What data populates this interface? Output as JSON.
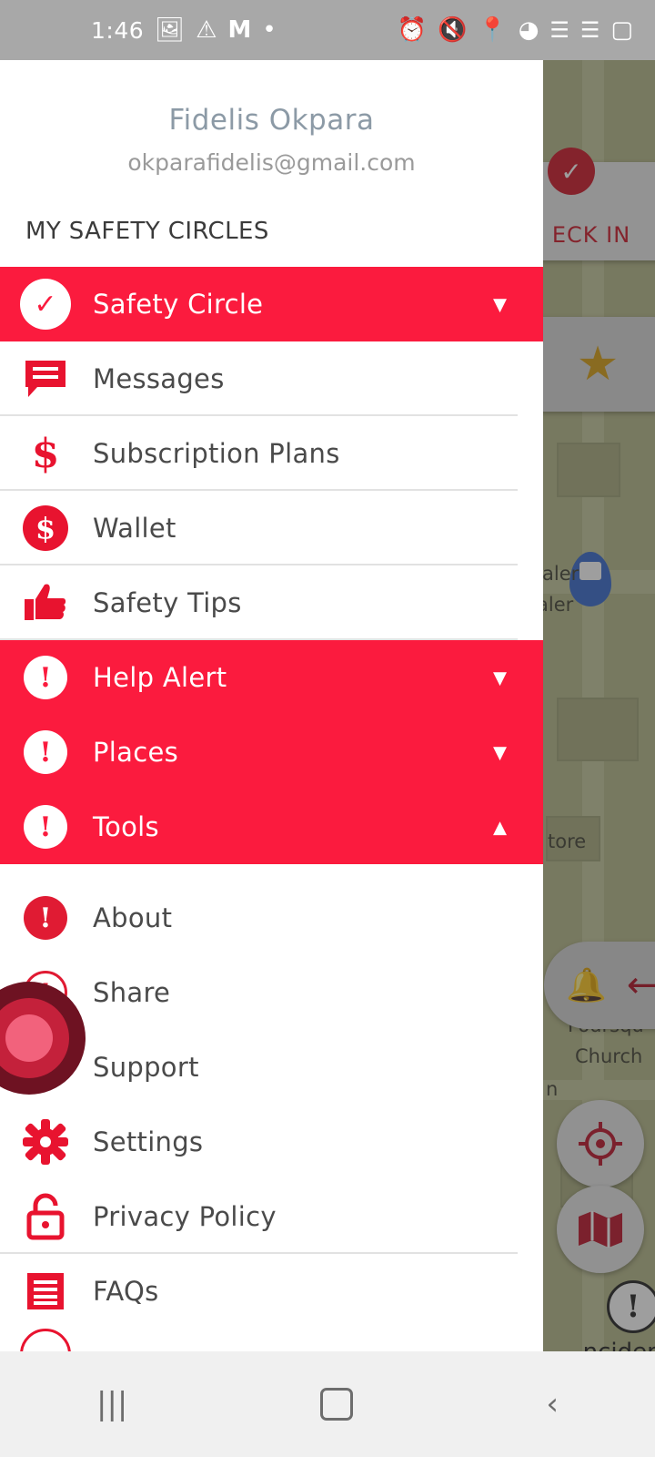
{
  "statusbar": {
    "clock": "1:46",
    "left_icons": [
      "image-icon",
      "warning-triangle-icon",
      "gmail-icon",
      "dot-icon"
    ],
    "right_icons": [
      "alarm-clock-icon",
      "mute-vibrate-icon",
      "location-pin-icon",
      "wifi-icon",
      "signal-bars-icon",
      "signal-bars-2-icon",
      "battery-icon"
    ]
  },
  "drawer": {
    "profile": {
      "name": "Fidelis Okpara",
      "email": "okparafidelis@gmail.com"
    },
    "section_title": "MY SAFETY CIRCLES",
    "accent_color": "#fb1b3e",
    "items": [
      {
        "label": "Safety Circle",
        "icon": "check-circle-icon",
        "highlighted": true,
        "chevron": "down"
      },
      {
        "label": "Messages",
        "icon": "chat-bubble-icon",
        "highlighted": false,
        "chevron": ""
      },
      {
        "label": "Subscription Plans",
        "icon": "dollar-sign-icon",
        "highlighted": false,
        "chevron": ""
      },
      {
        "label": "Wallet",
        "icon": "dollar-circle-icon",
        "highlighted": false,
        "chevron": ""
      },
      {
        "label": "Safety Tips",
        "icon": "thumbs-up-icon",
        "highlighted": false,
        "chevron": ""
      },
      {
        "label": "Help Alert",
        "icon": "exclamation-circle-icon",
        "highlighted": true,
        "chevron": "down"
      },
      {
        "label": "Places",
        "icon": "exclamation-circle-icon",
        "highlighted": true,
        "chevron": "down"
      },
      {
        "label": "Tools",
        "icon": "exclamation-circle-icon",
        "highlighted": true,
        "chevron": "up"
      },
      {
        "label": "About",
        "icon": "exclamation-circle-red-icon",
        "highlighted": false,
        "chevron": ""
      },
      {
        "label": "Share",
        "icon": "exclamation-circle-outline-icon",
        "highlighted": false,
        "chevron": ""
      },
      {
        "label": "Support",
        "icon": "headset-contact-icon",
        "highlighted": false,
        "chevron": ""
      },
      {
        "label": "Settings",
        "icon": "gear-icon",
        "highlighted": false,
        "chevron": ""
      },
      {
        "label": "Privacy Policy",
        "icon": "lock-icon",
        "highlighted": false,
        "chevron": ""
      },
      {
        "label": "FAQs",
        "icon": "list-document-icon",
        "highlighted": false,
        "chevron": ""
      }
    ]
  },
  "map": {
    "labels": [
      "aler",
      "aler",
      "tore",
      "n",
      "Foursqu",
      "Church"
    ],
    "checkin": {
      "label": "ECK IN",
      "badge_icon": "check-shield-icon"
    },
    "favorite_icon": "star-icon",
    "bell_icon": "bell-alert-icon",
    "back_arrow_icon": "arrow-left-icon",
    "locate_icon": "crosshair-target-icon",
    "map_layers_icon": "map-icon",
    "incidents": {
      "label": "ncidents",
      "icon": "exclamation-circle-outline-icon"
    },
    "sos_button_icon": "sos-pulse-button"
  },
  "navbar": {
    "recents_icon": "recents-icon",
    "home_icon": "home-square-icon",
    "back_icon": "back-chevron-icon"
  }
}
